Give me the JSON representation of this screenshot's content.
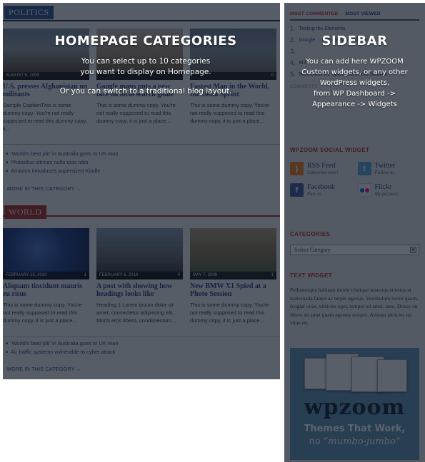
{
  "main": {
    "sections": [
      {
        "label": "POLITICS",
        "posts": [
          {
            "date": "AUGUST 6, 2009",
            "comments": "",
            "title": "U.S. presses Afghanistan on militants",
            "excerpt": "Sample CaptionThis is some dummy copy. You're not really supposed to read this dummy copy, it..."
          },
          {
            "date": "",
            "comments": "",
            "title": "Google maps puts a new face on local search game",
            "excerpt": "This is some dummy copy. You're not really supposed to read this dummy copy, it is just a place..."
          },
          {
            "date": "",
            "comments": "0",
            "title": "Fastest Man in the World, the 100m Sprint",
            "excerpt": "This is some dummy copy. You're not really supposed to read this dummy copy, it is just a place..."
          }
        ],
        "more_posts": [
          "'World's best job' in Australia goes to UK man",
          "Phasellus ultrices nulla quis nibh",
          "Amazon introduces supersized Kindle"
        ],
        "more_link": "MORE IN THIS CATEGORY →"
      },
      {
        "label": "WORLD",
        "posts": [
          {
            "date": "FEBRUARY 15, 2010",
            "comments": "1",
            "title": "Aliquam tincidunt mauris eu risus",
            "excerpt": "This is some dummy copy. You're not really supposed to read this dummy copy, it is just a place..."
          },
          {
            "date": "FEBRUARY 6, 2010",
            "comments": "0",
            "title": "A post with showing how headings looks like",
            "excerpt": "Heading 1 Lorem ipsum dolor sit amet, consectetur adipiscing elit. Morbi eros libero, condimentum..."
          },
          {
            "date": "MAY 7, 2009",
            "comments": "1",
            "title": "New BMW X1 Spied at a Photo Session",
            "excerpt": "This is some dummy copy. You're not really supposed to read this dummy copy, it is just a place..."
          }
        ],
        "more_posts": [
          "'World's best job' in Australia goes to UK man",
          "Air traffic systems vulnerable to cyber attack"
        ],
        "more_link": "MORE IN THIS CATEGORY →"
      }
    ]
  },
  "overlay_main": {
    "title": "HOMEPAGE CATEGORIES",
    "line1": "You can select up to 10 categories",
    "line2": "you want to display on Homepage.",
    "line3": "Or you can switch to a traditional blog layout."
  },
  "overlay_sidebar": {
    "title": "SIDEBAR",
    "line1": "You can add here WPZOOM",
    "line2": "Custom widgets, or any other",
    "line3": "WordPress widgets,",
    "line4": "from WP Dashboard ->",
    "line5": "Appearance -> Widgets"
  },
  "sidebar": {
    "tabs": {
      "active": "MOST COMMENTED",
      "inactive": "MOST VIEWED"
    },
    "popular": [
      {
        "num": "1.",
        "title": "Testing the Elements"
      },
      {
        "num": "2.",
        "title": "Google ... Monopoly board game"
      },
      {
        "num": "3.",
        "title": ""
      },
      {
        "num": "4.",
        "title": "M3"
      },
      {
        "num": "5.",
        "title": "New BMW X1 Spied at a Photo Session"
      }
    ],
    "comments_label": "COMMENTS",
    "social": {
      "title": "WPZOOM SOCIAL WIDGET",
      "items": [
        {
          "name": "RSS Feed",
          "sub": "Subscribe now!"
        },
        {
          "name": "Twitter",
          "sub": "Follow us"
        },
        {
          "name": "Facebook",
          "sub": "Fan us"
        },
        {
          "name": "Flickr",
          "sub": "My pictures"
        }
      ]
    },
    "categories": {
      "title": "CATEGORIES",
      "select": "Select Category"
    },
    "text_widget": {
      "title": "TEXT WIDGET",
      "body": "Pellentesque habitant morbi tristique senectus et netus et malesuada fames ac turpis egestas. Vestibulum tortor quam, feugiat vitae, ultricies eget, tempor sit amet, ante. Donec eu libero sit amet quam egestas semper. Aenean ultricies mi vitae est."
    },
    "ad": {
      "logo": "wpzoom",
      "tag1": "Themes That Work,",
      "tag2_prefix": "no ",
      "tag2_em": "“mumbo-jumbo”"
    }
  }
}
